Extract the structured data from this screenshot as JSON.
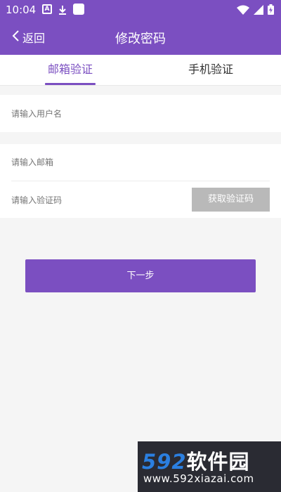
{
  "status_bar": {
    "time": "10:04",
    "left_icons": [
      "a-icon",
      "download-icon",
      "app-square-icon"
    ],
    "right_icons": [
      "wifi-icon",
      "signal-icon",
      "battery-charging-icon"
    ]
  },
  "app_bar": {
    "back_label": "返回",
    "title": "修改密码"
  },
  "tabs": [
    {
      "label": "邮箱验证",
      "active": true
    },
    {
      "label": "手机验证",
      "active": false
    }
  ],
  "form": {
    "username_placeholder": "请输入用户名",
    "email_placeholder": "请输入邮箱",
    "code_placeholder": "请输入验证码",
    "get_code_label": "获取验证码",
    "next_label": "下一步"
  },
  "watermark": {
    "number": "592",
    "brand": "软件园",
    "url": "www.592xiazai.com"
  },
  "colors": {
    "primary": "#7b4fc1",
    "background": "#f5f5f5",
    "disabled_button": "#b9b9b9",
    "watermark_bg": "#2a2b33",
    "watermark_number": "#2b7fe0"
  }
}
